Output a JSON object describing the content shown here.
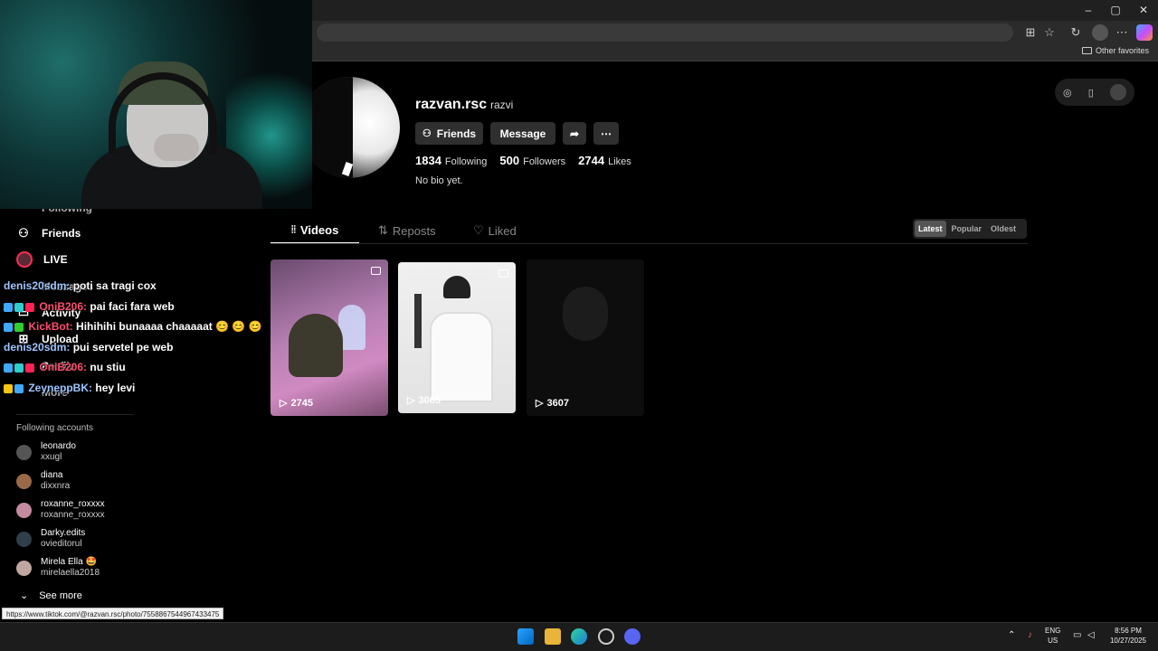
{
  "browser": {
    "other_favorites": "Other favorites",
    "window_controls": [
      "–",
      "▢",
      "✕"
    ]
  },
  "chat": [
    {
      "user": "denis20sdm:",
      "msg": "poti sa tragi cox",
      "user_color": "#9ec5ff"
    },
    {
      "user": "OniB206:",
      "msg": "pai faci fara web",
      "user_color": "#ff4d6d"
    },
    {
      "user": "KickBot:",
      "msg": "Hihihihi bunaaaa chaaaaat 😊 😊 😊",
      "user_color": "#ff4d6d"
    },
    {
      "user": "denis20sdm:",
      "msg": "pui servetel pe web",
      "user_color": "#9ec5ff"
    },
    {
      "user": "OniB206:",
      "msg": "nu stiu",
      "user_color": "#ff4d6d"
    },
    {
      "user": "ZeyneppBK:",
      "msg": "hey levi",
      "user_color": "#9ec5ff"
    }
  ],
  "sidebar": {
    "nav": [
      {
        "label": "Following",
        "icon": "following-icon"
      },
      {
        "label": "Friends",
        "icon": "friends-icon"
      },
      {
        "label": "LIVE",
        "icon": "live-icon"
      },
      {
        "label": "Messages",
        "icon": "messages-icon"
      },
      {
        "label": "Activity",
        "icon": "activity-icon"
      },
      {
        "label": "Upload",
        "icon": "upload-icon"
      },
      {
        "label": "Profile",
        "icon": "profile-icon"
      },
      {
        "label": "More",
        "icon": "more-icon"
      }
    ],
    "following_header": "Following accounts",
    "accounts": [
      {
        "name": "leonardo",
        "user": "xxugl"
      },
      {
        "name": "diana",
        "user": "dixxnra"
      },
      {
        "name": "roxanne_roxxxx",
        "user": "roxanne_roxxxx"
      },
      {
        "name": "Darky.edits",
        "user": "ovieditorul"
      },
      {
        "name": "Mirela Ella 🤩",
        "user": "mirelaella2018"
      }
    ],
    "see_more": "See more"
  },
  "profile": {
    "username": "razvan.rsc",
    "nickname": "razvi",
    "friends_btn": "Friends",
    "message_btn": "Message",
    "following_count": "1834",
    "following_label": "Following",
    "followers_count": "500",
    "followers_label": "Followers",
    "likes_count": "2744",
    "likes_label": "Likes",
    "bio": "No bio yet."
  },
  "tabs": [
    {
      "label": "Videos",
      "icon": "grid-icon"
    },
    {
      "label": "Reposts",
      "icon": "repost-icon"
    },
    {
      "label": "Liked",
      "icon": "heart-icon"
    }
  ],
  "sort": [
    "Latest",
    "Popular",
    "Oldest"
  ],
  "videos": [
    {
      "views": "2745",
      "photo": true
    },
    {
      "views": "3065",
      "photo": true
    },
    {
      "views": "3607",
      "photo": false
    }
  ],
  "status_url": "https://www.tiktok.com/@razvan.rsc/photo/7558867544967433475",
  "taskbar": {
    "lang": "ENG",
    "region": "US",
    "time": "8:56 PM",
    "date": "10/27/2025"
  }
}
